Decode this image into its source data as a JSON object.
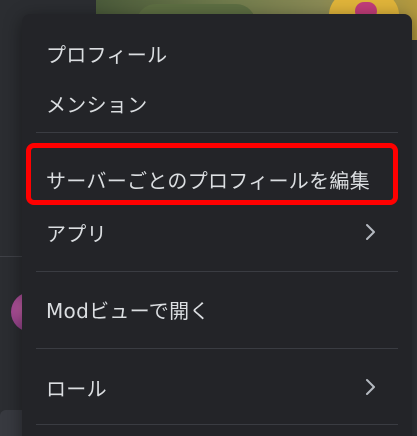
{
  "context_menu": {
    "items": [
      {
        "label": "プロフィール",
        "submenu": false
      },
      {
        "label": "メンション",
        "submenu": false
      },
      {
        "label": "サーバーごとのプロフィールを編集",
        "submenu": false
      },
      {
        "label": "アプリ",
        "submenu": true
      },
      {
        "label": "Modビューで開く",
        "submenu": false
      },
      {
        "label": "ロール",
        "submenu": true
      }
    ],
    "highlight_color": "#ff0000",
    "background_color": "#232428",
    "text_color": "#dbdee1"
  },
  "icons": {
    "submenu": "chevron-right-icon"
  }
}
